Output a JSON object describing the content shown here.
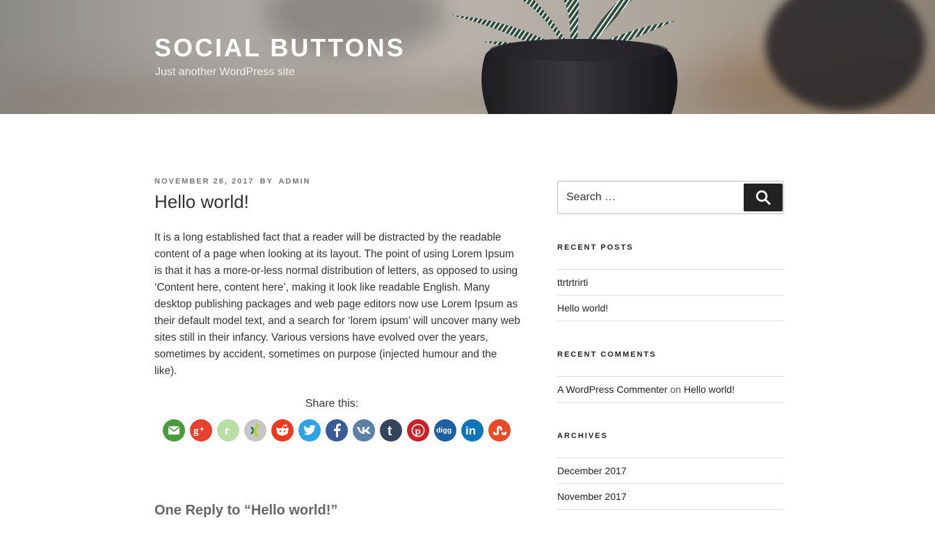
{
  "header": {
    "site_title": "SOCIAL BUTTONS",
    "site_description": "Just another WordPress site"
  },
  "post": {
    "date": "NOVEMBER 28, 2017",
    "by": "BY",
    "author": "ADMIN",
    "title": "Hello world!",
    "content": "It is a long established fact that a reader will be distracted by the readable content of a page when looking at its layout. The point of using Lorem Ipsum is that it has a more-or-less normal distribution of letters, as opposed to using ‘Content here, content here’, making it look like readable English. Many desktop publishing packages and web page editors now use Lorem Ipsum as their default model text, and a search for ‘lorem ipsum’ will uncover many web sites still in their infancy. Various versions have evolved over the years, sometimes by accident, sometimes on purpose (injected humour and the like).",
    "share_label": "Share this:",
    "share_buttons": [
      {
        "name": "email",
        "icon": "envelope-icon",
        "color": "#4a9b3b"
      },
      {
        "name": "google-plus",
        "icon": "google-plus-icon",
        "color": "#e8402f"
      },
      {
        "name": "renren",
        "icon": "renren-icon",
        "color": "#b8e0a6"
      },
      {
        "name": "xing",
        "icon": "xing-icon",
        "color": "#c6c6c6"
      },
      {
        "name": "reddit",
        "icon": "reddit-icon",
        "color": "#ee3b1e"
      },
      {
        "name": "twitter",
        "icon": "twitter-bird-icon",
        "color": "#2fa3e6"
      },
      {
        "name": "facebook",
        "icon": "facebook-icon",
        "color": "#3a5a99"
      },
      {
        "name": "vk",
        "icon": "vk-icon",
        "color": "#5b7fa6"
      },
      {
        "name": "tumblr",
        "icon": "tumblr-icon",
        "color": "#35465c"
      },
      {
        "name": "pinterest",
        "icon": "pinterest-icon",
        "color": "#cb2027"
      },
      {
        "name": "digg",
        "icon": "digg-icon",
        "color": "#1d5fa3"
      },
      {
        "name": "linkedin",
        "icon": "linkedin-icon",
        "color": "#0e76b8"
      },
      {
        "name": "stumbleupon",
        "icon": "stumbleupon-icon",
        "color": "#eb4823"
      }
    ],
    "comments_title": "One Reply to “Hello world!”"
  },
  "sidebar": {
    "search": {
      "placeholder": "Search …"
    },
    "recent_posts": {
      "title": "RECENT POSTS",
      "items": [
        "ttrtrtrirti",
        "Hello world!"
      ]
    },
    "recent_comments": {
      "title": "RECENT COMMENTS",
      "author": "A WordPress Commenter",
      "on": "on",
      "post": "Hello world!"
    },
    "archives": {
      "title": "ARCHIVES",
      "items": [
        "December 2017",
        "November 2017"
      ]
    }
  }
}
